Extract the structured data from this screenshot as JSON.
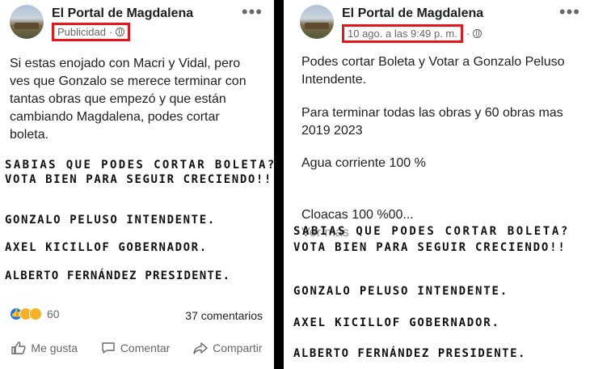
{
  "left": {
    "page_name": "El Portal de Magdalena",
    "meta": "Publicidad",
    "meta_sep": "·",
    "body": "Si estas enojado con Macri y Vidal, pero\nves que Gonzalo se merece terminar con\ntantas obras que empezó y que están\ncambiando Magdalena, podes cortar\nboleta.",
    "shout_lines": [
      "SABIAS QUE PODES CORTAR BOLETA?",
      "VOTA BIEN PARA SEGUIR CRECIENDO!!",
      "GONZALO PELUSO INTENDENTE.",
      "AXEL KICILLOF GOBERNADOR.",
      "ALBERTO FERNÁNDEZ PRESIDENTE."
    ],
    "reaction_count": "60",
    "comments": "37 comentarios",
    "actions": [
      "Me gusta",
      "Comentar",
      "Compartir"
    ]
  },
  "right": {
    "page_name": "El Portal de Magdalena",
    "meta": "10 ago. a las 9:49 p. m.",
    "meta_sep": "·",
    "body_lines": [
      "Podes cortar Boleta y Votar a Gonzalo Peluso",
      "Intendente.",
      "Para terminar todas las obras y 60 obras mas",
      "2019 2023",
      "Agua corriente 100 %",
      "Cloacas 100 %00..."
    ],
    "see_more": "Ver más",
    "shout_lines": [
      "SABIAS QUE PODES CORTAR BOLETA?",
      "VOTA BIEN PARA SEGUIR CRECIENDO!!",
      "GONZALO PELUSO INTENDENTE.",
      "AXEL KICILLOF GOBERNADOR.",
      "ALBERTO FERNÁNDEZ PRESIDENTE."
    ]
  },
  "icons": {
    "globe": "globe-icon",
    "more": "more-options-icon",
    "like": "thumbs-up-icon",
    "comment": "comment-bubble-icon",
    "share": "share-arrow-icon"
  },
  "colors": {
    "highlight": "#e8161b",
    "meta": "#65676b",
    "like_blue": "#1877f2"
  }
}
